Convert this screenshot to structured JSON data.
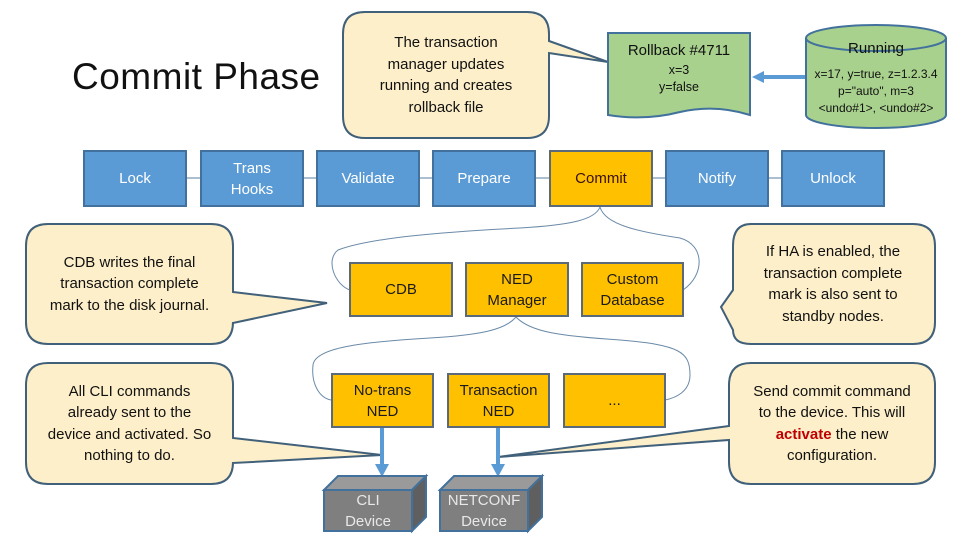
{
  "title": "Commit Phase",
  "phases": [
    {
      "label": "Lock",
      "active": false
    },
    {
      "label": "Trans\nHooks",
      "active": false
    },
    {
      "label": "Validate",
      "active": false
    },
    {
      "label": "Prepare",
      "active": false
    },
    {
      "label": "Commit",
      "active": true
    },
    {
      "label": "Notify",
      "active": false
    },
    {
      "label": "Unlock",
      "active": false
    }
  ],
  "commit_targets": [
    "CDB",
    "NED\nManager",
    "Custom\nDatabase"
  ],
  "ned_types": [
    "No-trans\nNED",
    "Transaction\nNED",
    "..."
  ],
  "devices": [
    "CLI\nDevice",
    "NETCONF\nDevice"
  ],
  "rollback": {
    "title": "Rollback #4711",
    "lines": [
      "x=3",
      "y=false"
    ]
  },
  "running": {
    "title": "Running",
    "lines": [
      "x=17, y=true, z=1.2.3.4",
      "p=\"auto\", m=3",
      "<undo#1>, <undo#2>"
    ]
  },
  "callouts": {
    "transaction_manager": "The transaction\nmanager updates\nrunning and creates\nrollback file",
    "cdb": "CDB writes the final\ntransaction complete\nmark to the disk journal.",
    "cli": "All CLI commands\nalready sent to the\ndevice and activated. So\nnothing to do.",
    "ha": "If HA is enabled, the\ntransaction complete\nmark is also sent to\nstandby nodes.",
    "netconf": {
      "before": "Send commit command\nto the device. This will\n",
      "highlight": "activate",
      "after": " the new\nconfiguration."
    }
  },
  "colors": {
    "phase_blue": "#5b9bd5",
    "active_orange": "#ffc000",
    "callout_fill": "#fdefc9",
    "store_green": "#a9d18e",
    "device_gray": "#7f7f7f",
    "highlight_red": "#c00000"
  }
}
